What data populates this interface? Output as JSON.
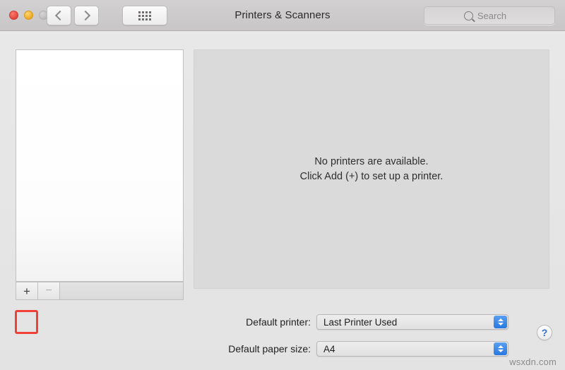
{
  "window": {
    "title": "Printers & Scanners",
    "traffic_lights": [
      {
        "name": "close",
        "color": "#e0443a"
      },
      {
        "name": "minimize",
        "color": "#e9a724"
      },
      {
        "name": "zoom",
        "color": "#bcbaba"
      }
    ]
  },
  "toolbar": {
    "back_label": "",
    "forward_label": "",
    "show_all_label": "",
    "search": {
      "placeholder": "Search",
      "value": ""
    }
  },
  "sidebar": {
    "printers": [],
    "add_button_label": "+",
    "remove_button_label": "−"
  },
  "detail": {
    "empty_message_line1": "No printers are available.",
    "empty_message_line2": "Click Add (+) to set up a printer."
  },
  "settings": {
    "default_printer": {
      "label": "Default printer:",
      "value": "Last Printer Used"
    },
    "default_paper_size": {
      "label": "Default paper size:",
      "value": "A4"
    }
  },
  "help": {
    "label": "?"
  },
  "watermark": {
    "text": "wsxdn.com"
  },
  "annotation": {
    "color": "#ef4136",
    "target": "add-printer-button"
  }
}
